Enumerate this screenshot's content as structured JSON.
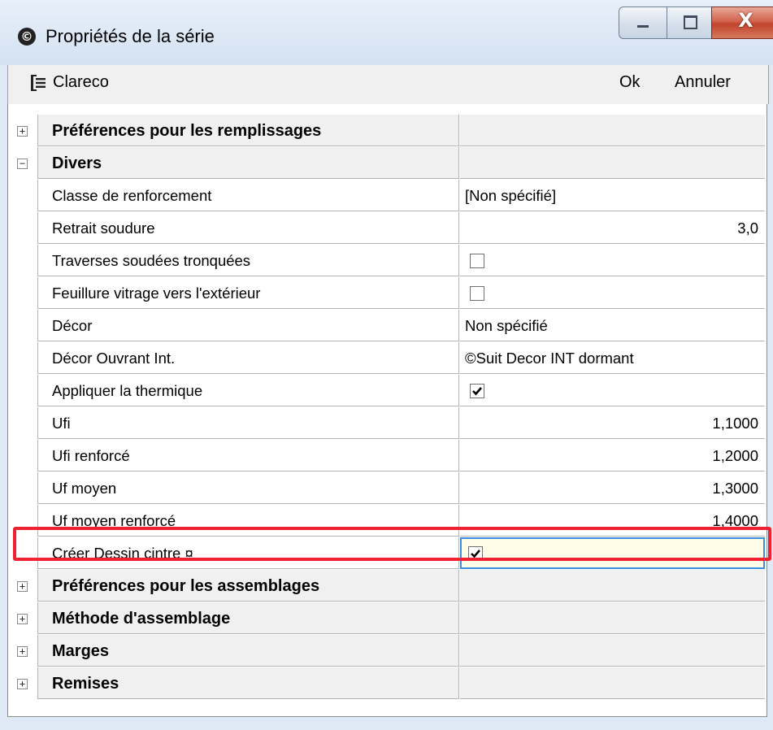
{
  "window": {
    "title": "Propriétés de la série",
    "app_icon_glyph": "©",
    "close_glyph": "X"
  },
  "toolbar": {
    "label": "Clareco",
    "ok_label": "Ok",
    "cancel_label": "Annuler"
  },
  "rows": [
    {
      "type": "category",
      "label": "Préférences pour les remplissages",
      "expanded": false
    },
    {
      "type": "category",
      "label": "Divers",
      "expanded": true
    },
    {
      "type": "text",
      "label": "Classe de renforcement",
      "value": "[Non spécifié]"
    },
    {
      "type": "number",
      "label": "Retrait soudure",
      "value": "3,0"
    },
    {
      "type": "checkbox",
      "label": "Traverses soudées tronquées",
      "checked": false
    },
    {
      "type": "checkbox",
      "label": "Feuillure vitrage vers l'extérieur",
      "checked": false
    },
    {
      "type": "text",
      "label": "Décor",
      "value": "Non spécifié"
    },
    {
      "type": "text",
      "label": "Décor Ouvrant Int.",
      "value": "©Suit Decor INT dormant"
    },
    {
      "type": "checkbox",
      "label": "Appliquer la thermique",
      "checked": true
    },
    {
      "type": "number",
      "label": "Ufi",
      "value": "1,1000"
    },
    {
      "type": "number",
      "label": "Ufi renforcé",
      "value": "1,2000"
    },
    {
      "type": "number",
      "label": "Uf moyen",
      "value": "1,3000"
    },
    {
      "type": "number",
      "label": "Uf moyen renforcé",
      "value": "1,4000"
    },
    {
      "type": "checkbox",
      "label": "Créer Dessin cintre ¤",
      "checked": true,
      "editing": true
    },
    {
      "type": "category",
      "label": "Préférences pour les assemblages",
      "expanded": false
    },
    {
      "type": "category",
      "label": "Méthode d'assemblage",
      "expanded": false
    },
    {
      "type": "category",
      "label": "Marges",
      "expanded": false
    },
    {
      "type": "category",
      "label": "Remises",
      "expanded": false
    }
  ],
  "colors": {
    "highlight": "#ee2233",
    "edit_border": "#3b8ee0",
    "edit_bg": "#fffde8",
    "category_bg": "#f0f0f0"
  }
}
